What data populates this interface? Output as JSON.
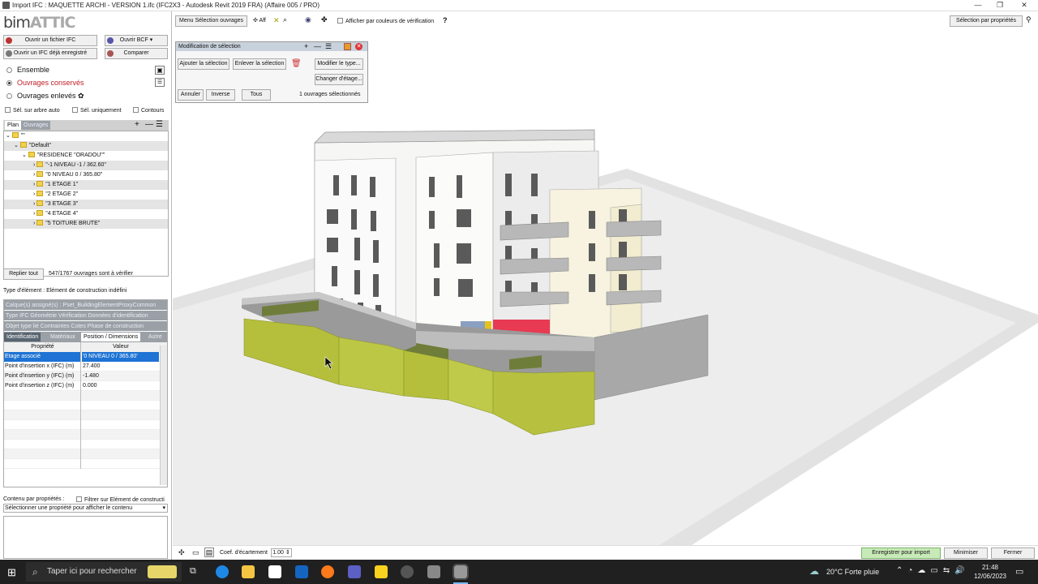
{
  "window": {
    "title": "Import IFC : MAQUETTE ARCHI - VERSION 1.ifc (IFC2X3 - Autodesk Revit 2019 FRA)  (Affaire 005 / PRO)",
    "controls": [
      "—",
      "❐",
      "✕"
    ]
  },
  "logo": {
    "part1": "bim",
    "part2": "ATTIC"
  },
  "left_buttons": {
    "open_ifc": "Ouvrir un fichier IFC",
    "open_bcf": "Ouvrir BCF",
    "open_saved_ifc": "Ouvrir un IFC déjà enregistré",
    "compare": "Comparer"
  },
  "filter_radios": [
    {
      "label": "Ensemble",
      "selected": false,
      "color": "#111111"
    },
    {
      "label": "Ouvrages conservés",
      "selected": true,
      "color": "#c0202a"
    },
    {
      "label": "Ouvrages enlevés",
      "selected": false,
      "color": "#111111"
    }
  ],
  "checkbox_row": {
    "auto": "Sél. sur arbre auto",
    "only": "Sél. uniquement",
    "contours": "Contours"
  },
  "tree_tabs": {
    "plan": "Plan",
    "ouvrages": "Ouvrages"
  },
  "tree_rows": [
    {
      "text": "\"\"",
      "indent": 0
    },
    {
      "text": "\"Default\"",
      "indent": 1
    },
    {
      "text": "\"RESIDENCE \"ORADOU\"\"",
      "indent": 2
    },
    {
      "text": "\"-1 NIVEAU -1 / 362.60\"",
      "indent": 3
    },
    {
      "text": "\"0 NIVEAU 0 / 365.80\"",
      "indent": 3
    },
    {
      "text": "\"1 ETAGE 1\"",
      "indent": 3
    },
    {
      "text": "\"2 ETAGE 2\"",
      "indent": 3
    },
    {
      "text": "\"3 ETAGE 3\"",
      "indent": 3
    },
    {
      "text": "\"4 ETAGE 4\"",
      "indent": 3
    },
    {
      "text": "\"5 TOITURE BRUTE\"",
      "indent": 3
    }
  ],
  "collapse_button": "Replier tout",
  "count_status": "547/1767 ouvrages sont à vérifier",
  "element_type": "Type d'élément : Elément de construction indéfini",
  "grey_rows": [
    "Calque(s) assigné(s) :  Pset_BuildingElementProxyCommon",
    "Type IFC Géométrie  Vérification  Données d'identification",
    "Objet type lié  Contraintes  Cotes  Phase de construction"
  ],
  "prop_tabs": [
    "Identification",
    "Matériaux",
    "Position / Dimensions",
    "Autre"
  ],
  "prop_headers": {
    "property": "Propriété",
    "value": "Valeur"
  },
  "properties": [
    {
      "key": "Etage associé",
      "value": "'0 NIVEAU 0 / 365.80'"
    },
    {
      "key": "Point d'insertion x (IFC) (m)",
      "value": "27.400"
    },
    {
      "key": "Point d'insertion y (IFC) (m)",
      "value": "-1.480"
    },
    {
      "key": "Point d'insertion z (IFC) (m)",
      "value": "0.000"
    }
  ],
  "content_by_props": {
    "label": "Contenu par propriétés :",
    "filter": "Filtrer sur Elément de constructi",
    "select": "Sélectionner une propriété pour afficher le contenu"
  },
  "top_toolbar": {
    "menu": "Menu Sélection ouvrages",
    "aff": "Aff",
    "color_check": "Afficher par couleurs de vérification",
    "help": "?",
    "select_props": "Sélection par propriétés"
  },
  "popup": {
    "title": "Modification de sélection",
    "add": "Ajouter la sélection",
    "remove": "Enlever la sélection",
    "modify_type": "Modifier le type...",
    "change_floor": "Changer d'étage...",
    "cancel": "Annuler",
    "inverse": "Inverse",
    "all": "Tous",
    "status": "1  ouvrages sélectionnés"
  },
  "bottom_bar": {
    "coef_label": "Coef. d'écartement",
    "coef_value": "1.00",
    "save_import": "Enregistrer pour import",
    "minimize": "Minimiser",
    "close": "Fermer"
  },
  "taskbar": {
    "search": "Taper ici pour rechercher",
    "weather": "20°C  Forte pluie",
    "time": "21:48",
    "date": "12/06/2023"
  }
}
